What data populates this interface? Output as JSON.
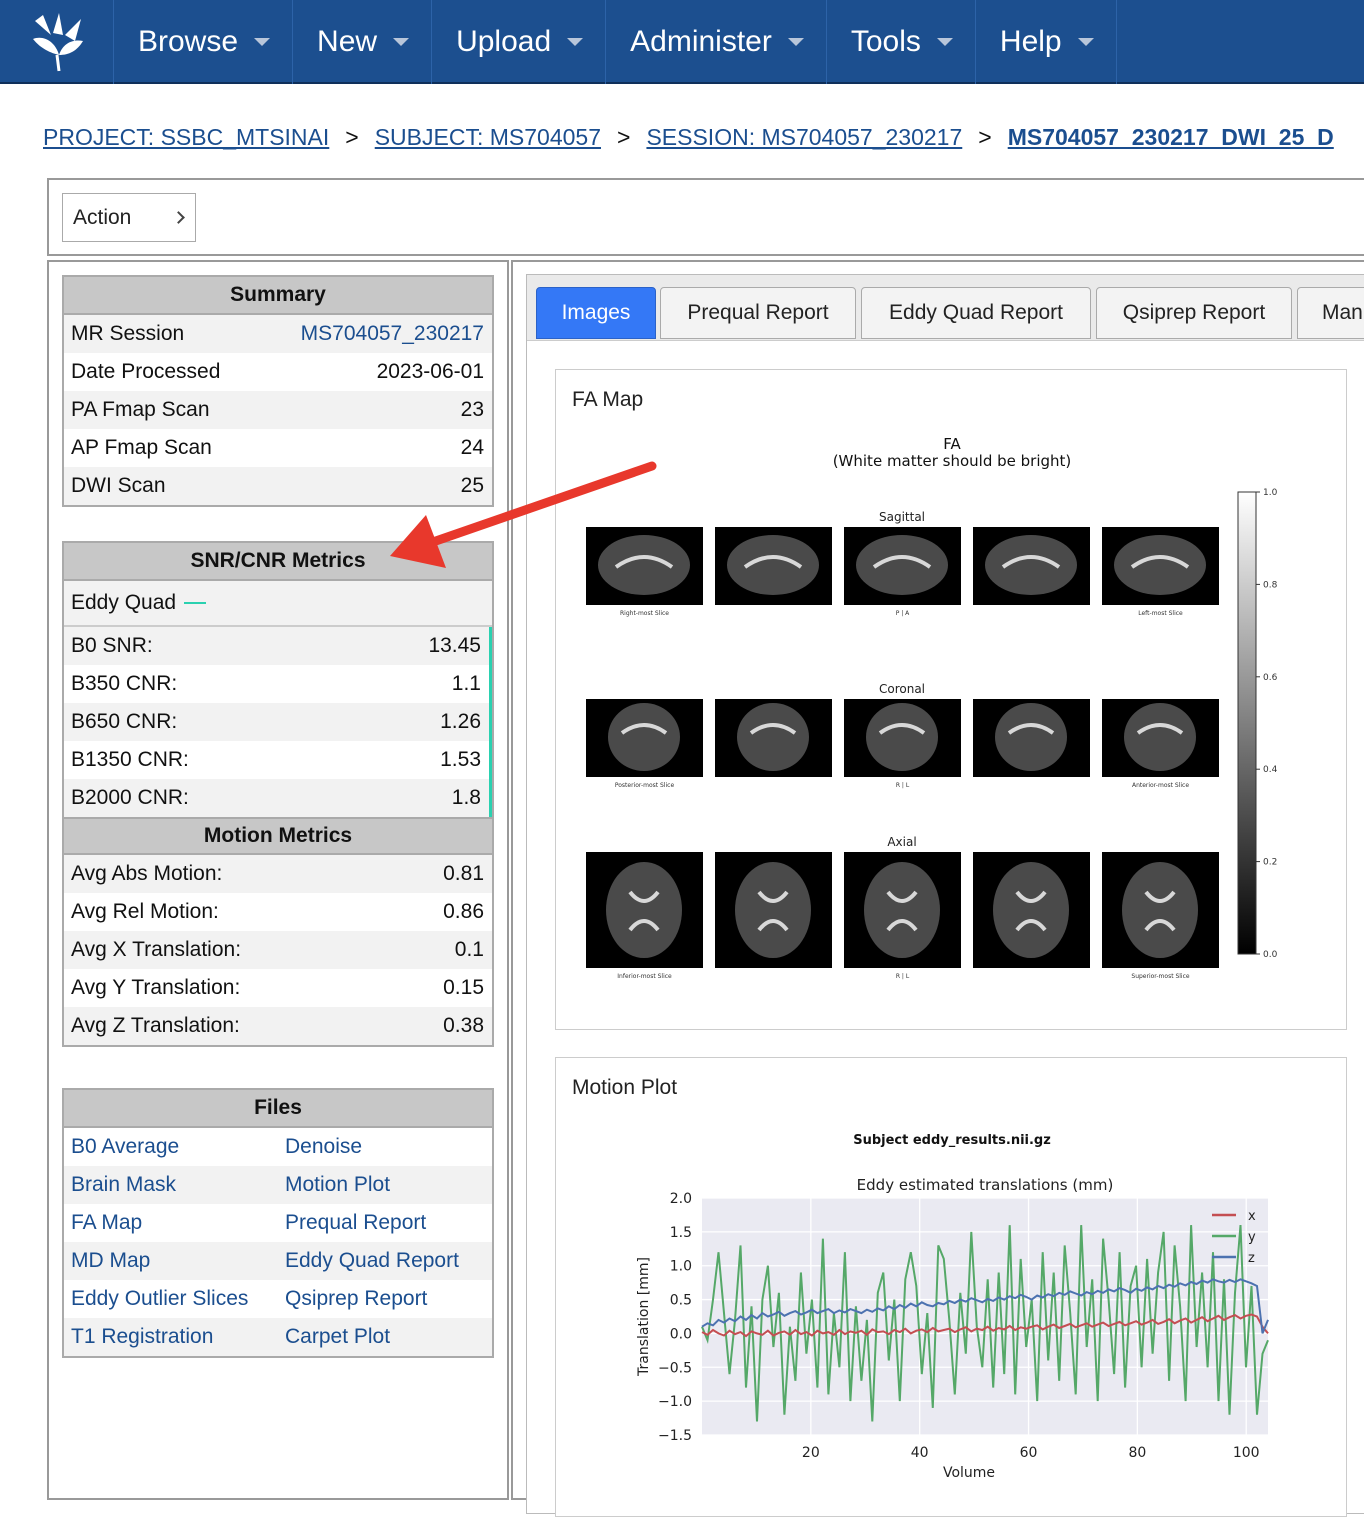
{
  "nav": {
    "items": [
      {
        "label": "Browse"
      },
      {
        "label": "New"
      },
      {
        "label": "Upload"
      },
      {
        "label": "Administer"
      },
      {
        "label": "Tools"
      },
      {
        "label": "Help"
      }
    ]
  },
  "breadcrumb": {
    "project": "PROJECT: SSBC_MTSINAI",
    "subject": "SUBJECT: MS704057",
    "session": "SESSION: MS704057_230217",
    "current": "MS704057_230217_DWI_25_D",
    "separator": ">"
  },
  "action": {
    "label": "Action"
  },
  "summary": {
    "title": "Summary",
    "rows": [
      {
        "label": "MR Session",
        "value": "MS704057_230217"
      },
      {
        "label": "Date Processed",
        "value": "2023-06-01"
      },
      {
        "label": "PA Fmap Scan",
        "value": "23"
      },
      {
        "label": "AP Fmap Scan",
        "value": "24"
      },
      {
        "label": "DWI Scan",
        "value": "25"
      }
    ]
  },
  "snr": {
    "title": "SNR/CNR Metrics",
    "group": "Eddy Quad",
    "rows": [
      {
        "label": "B0 SNR:",
        "value": "13.45"
      },
      {
        "label": "B350 CNR:",
        "value": "1.1"
      },
      {
        "label": "B650 CNR:",
        "value": "1.26"
      },
      {
        "label": "B1350 CNR:",
        "value": "1.53"
      },
      {
        "label": "B2000 CNR:",
        "value": "1.8"
      }
    ]
  },
  "motion": {
    "title": "Motion Metrics",
    "rows": [
      {
        "label": "Avg Abs Motion:",
        "value": "0.81"
      },
      {
        "label": "Avg Rel Motion:",
        "value": "0.86"
      },
      {
        "label": "Avg X Translation:",
        "value": "0.1"
      },
      {
        "label": "Avg Y Translation:",
        "value": "0.15"
      },
      {
        "label": "Avg Z Translation:",
        "value": "0.38"
      }
    ]
  },
  "files": {
    "title": "Files",
    "rows": [
      {
        "a": "B0 Average",
        "b": "Denoise"
      },
      {
        "a": "Brain Mask",
        "b": "Motion Plot"
      },
      {
        "a": "FA Map",
        "b": "Prequal Report"
      },
      {
        "a": "MD Map",
        "b": "Eddy Quad Report"
      },
      {
        "a": "Eddy Outlier Slices",
        "b": "Qsiprep Report"
      },
      {
        "a": "T1 Registration",
        "b": "Carpet Plot"
      }
    ]
  },
  "tabs": [
    {
      "label": "Images",
      "active": true
    },
    {
      "label": "Prequal Report"
    },
    {
      "label": "Eddy Quad Report"
    },
    {
      "label": "Qsiprep Report"
    },
    {
      "label": "Manu"
    }
  ],
  "fa_card": {
    "title": "FA Map",
    "fig_title": "FA",
    "fig_subtitle": "(White matter should be bright)",
    "rows": [
      {
        "label": "Sagittal",
        "captions": [
          "Right-most Slice",
          "",
          "P | A",
          "",
          "Left-most Slice"
        ]
      },
      {
        "label": "Coronal",
        "captions": [
          "Posterior-most Slice",
          "",
          "R | L",
          "",
          "Anterior-most Slice"
        ]
      },
      {
        "label": "Axial",
        "captions": [
          "Inferior-most Slice",
          "",
          "R | L",
          "",
          "Superior-most Slice"
        ]
      }
    ],
    "colorbar_ticks": [
      "1.0",
      "0.8",
      "0.6",
      "0.4",
      "0.2",
      "0.0"
    ]
  },
  "motion_card": {
    "title": "Motion Plot",
    "fig_title": "Subject eddy_results.nii.gz"
  },
  "chart_data": {
    "type": "line",
    "title": "Eddy estimated translations (mm)",
    "xlabel": "Volume",
    "ylabel": "Translation [mm]",
    "xlim": [
      0,
      104
    ],
    "ylim": [
      -1.5,
      2.0
    ],
    "xticks": [
      "20",
      "40",
      "60",
      "80",
      "100"
    ],
    "yticks": [
      "2.0",
      "1.5",
      "1.0",
      "0.5",
      "0.0",
      "−0.5",
      "−1.0",
      "−1.5"
    ],
    "legend": "top-right",
    "grid": true,
    "series": [
      {
        "name": "x",
        "color": "#c44e52",
        "values": [
          0.02,
          -0.02,
          0.05,
          0.0,
          -0.03,
          0.04,
          -0.01,
          0.02,
          -0.04,
          0.03,
          0.0,
          -0.02,
          0.04,
          -0.03,
          0.01,
          0.03,
          -0.02,
          0.05,
          -0.01,
          0.02,
          -0.03,
          0.04,
          0.0,
          0.02,
          -0.02,
          0.05,
          -0.01,
          0.03,
          0.01,
          0.04,
          -0.02,
          0.06,
          0.02,
          0.03,
          -0.01,
          0.05,
          0.02,
          0.07,
          0.0,
          0.04,
          0.06,
          0.02,
          0.08,
          0.03,
          0.05,
          0.07,
          0.02,
          0.06,
          0.09,
          0.03,
          0.07,
          0.05,
          0.1,
          0.04,
          0.08,
          0.06,
          0.11,
          0.05,
          0.09,
          0.07,
          0.1,
          0.12,
          0.06,
          0.1,
          0.13,
          0.08,
          0.11,
          0.14,
          0.09,
          0.12,
          0.15,
          0.1,
          0.13,
          0.16,
          0.11,
          0.14,
          0.17,
          0.12,
          0.15,
          0.18,
          0.13,
          0.16,
          0.2,
          0.14,
          0.17,
          0.21,
          0.15,
          0.19,
          0.22,
          0.16,
          0.2,
          0.24,
          0.18,
          0.22,
          0.26,
          0.2,
          0.24,
          0.27,
          0.22,
          0.26,
          0.28,
          0.25,
          0.1,
          0.0
        ]
      },
      {
        "name": "y",
        "color": "#55a868",
        "values": [
          0.1,
          -0.1,
          0.5,
          1.2,
          0.3,
          -0.6,
          0.2,
          1.3,
          -0.8,
          0.4,
          -1.3,
          0.5,
          1.0,
          -0.2,
          0.6,
          -1.2,
          0.1,
          -0.7,
          0.9,
          -0.3,
          0.5,
          -0.8,
          1.4,
          -0.9,
          0.3,
          -0.5,
          1.2,
          -1.0,
          0.4,
          -0.7,
          0.2,
          -1.3,
          0.6,
          0.9,
          -0.4,
          0.5,
          -1.0,
          0.8,
          1.2,
          0.7,
          -0.6,
          0.3,
          -1.1,
          1.3,
          1.1,
          0.2,
          -0.9,
          0.6,
          -0.3,
          1.5,
          0.1,
          -0.5,
          0.8,
          -0.8,
          0.9,
          -0.6,
          1.6,
          -0.9,
          1.1,
          -0.2,
          0.5,
          -1.0,
          1.2,
          -0.4,
          0.9,
          -0.7,
          1.3,
          0.3,
          -0.9,
          1.6,
          -0.2,
          0.8,
          -1.0,
          1.4,
          0.5,
          -0.6,
          1.2,
          -0.8,
          0.7,
          1.0,
          -0.5,
          1.1,
          -0.3,
          0.9,
          1.5,
          -0.7,
          1.3,
          0.4,
          -1.0,
          1.6,
          -0.2,
          0.9,
          -0.5,
          1.2,
          -1.0,
          0.8,
          -1.2,
          0.6,
          1.6,
          -0.5,
          0.7,
          -1.2,
          -0.3,
          -0.1
        ]
      },
      {
        "name": "z",
        "color": "#4c72b0",
        "values": [
          0.1,
          0.15,
          0.12,
          0.2,
          0.16,
          0.22,
          0.18,
          0.25,
          0.2,
          0.27,
          0.22,
          0.3,
          0.25,
          0.28,
          0.32,
          0.26,
          0.3,
          0.33,
          0.28,
          0.31,
          0.35,
          0.3,
          0.33,
          0.36,
          0.3,
          0.34,
          0.31,
          0.36,
          0.33,
          0.3,
          0.35,
          0.32,
          0.37,
          0.34,
          0.4,
          0.36,
          0.42,
          0.38,
          0.44,
          0.4,
          0.46,
          0.42,
          0.4,
          0.45,
          0.43,
          0.48,
          0.45,
          0.5,
          0.47,
          0.52,
          0.49,
          0.46,
          0.51,
          0.48,
          0.53,
          0.5,
          0.55,
          0.52,
          0.57,
          0.54,
          0.5,
          0.56,
          0.53,
          0.58,
          0.55,
          0.6,
          0.57,
          0.62,
          0.59,
          0.56,
          0.61,
          0.58,
          0.63,
          0.6,
          0.65,
          0.62,
          0.67,
          0.64,
          0.6,
          0.66,
          0.63,
          0.68,
          0.65,
          0.7,
          0.67,
          0.72,
          0.69,
          0.74,
          0.71,
          0.76,
          0.73,
          0.78,
          0.75,
          0.8,
          0.77,
          0.75,
          0.79,
          0.76,
          0.8,
          0.77,
          0.74,
          0.7,
          0.0,
          0.2
        ]
      }
    ]
  }
}
